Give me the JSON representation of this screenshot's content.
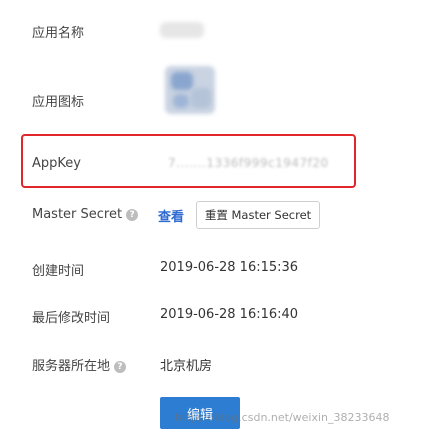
{
  "fields": {
    "app_name_label": "应用名称",
    "app_icon_label": "应用图标",
    "appkey_label": "AppKey",
    "appkey_value": "7.......1336f999c1947f20",
    "master_secret_label": "Master Secret",
    "master_secret_view": "查看",
    "master_secret_reset": "重置 Master Secret",
    "created_label": "创建时间",
    "created_value": "2019-06-28 16:15:36",
    "modified_label": "最后修改时间",
    "modified_value": "2019-06-28 16:16:40",
    "region_label": "服务器所在地",
    "region_value": "北京机房"
  },
  "help_icon_glyph": "?",
  "edit_button": "编辑",
  "watermark": "https://blog.csdn.net/weixin_38233648",
  "colors": {
    "highlight": "#e0262a",
    "link": "#2f6bd1",
    "primary": "#2d7dd2"
  }
}
